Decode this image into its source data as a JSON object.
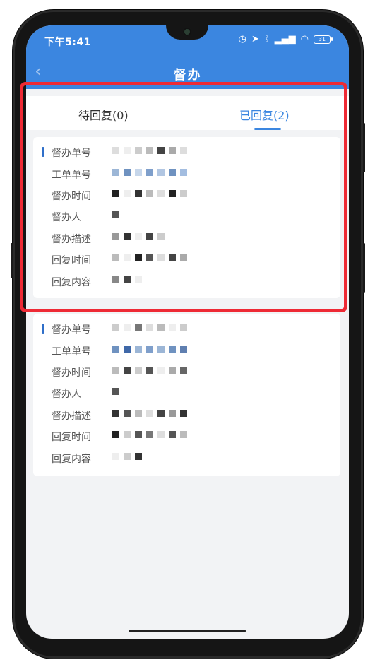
{
  "status_bar": {
    "time": "下午5:41",
    "battery": "31"
  },
  "header": {
    "title": "督办",
    "back_glyph": "‹"
  },
  "tabs": [
    {
      "label": "待回复(0)"
    },
    {
      "label": "已回复(2)"
    }
  ],
  "record_fields": [
    "督办单号",
    "工单单号",
    "督办时间",
    "督办人",
    "督办描述",
    "回复时间",
    "回复内容"
  ],
  "colors": {
    "header_bg": "#3b86e0",
    "accent": "#3b86e0",
    "highlight_border": "#ee2a35",
    "marker": "#2f6fc9"
  }
}
